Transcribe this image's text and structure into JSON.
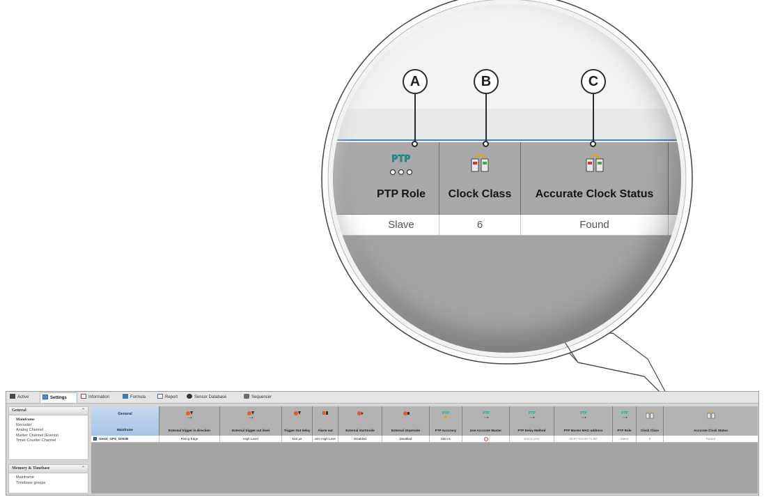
{
  "callouts": [
    "A",
    "B",
    "C"
  ],
  "zoom": {
    "columns": [
      {
        "title": "PTP Role",
        "value": "Slave",
        "icon": "ptp-icon"
      },
      {
        "title": "Clock Class",
        "value": "6",
        "icon": "clock-modules-icon"
      },
      {
        "title": "Accurate Clock Status",
        "value": "Found",
        "icon": "clock-modules-icon"
      }
    ]
  },
  "tabs": [
    {
      "label": "Active",
      "icon": "grid-icon",
      "active": false
    },
    {
      "label": "Settings",
      "icon": "settings-icon",
      "active": true
    },
    {
      "label": "Information",
      "icon": "info-icon",
      "active": false
    },
    {
      "label": "Formula",
      "icon": "formula-icon",
      "active": false
    },
    {
      "label": "Report",
      "icon": "report-icon",
      "active": false
    },
    {
      "label": "Sensor Database",
      "icon": "add-circle-icon",
      "active": false
    },
    {
      "label": "Sequencer",
      "icon": "sequencer-icon",
      "active": false
    }
  ],
  "sidebar": {
    "panels": [
      {
        "title": "General",
        "items": [
          {
            "label": "Mainframe",
            "bold": true
          },
          {
            "label": "Recorder",
            "bold": false
          },
          {
            "label": "Analog Channel",
            "bold": false
          },
          {
            "label": "Marker Channel (Events)",
            "bold": false
          },
          {
            "label": "Timer-Counter Channel",
            "bold": false
          }
        ]
      },
      {
        "title": "Memory & Timebase",
        "items": [
          {
            "label": "Mainframe",
            "bold": false
          },
          {
            "label": "Timebase groups",
            "bold": false
          }
        ]
      }
    ]
  },
  "table": {
    "group_header": "General",
    "columns": [
      {
        "label": "Mainframe",
        "icon": ""
      },
      {
        "label": "External trigger in direction",
        "icon": "trigger-icon"
      },
      {
        "label": "External trigger out level",
        "icon": "trigger-icon"
      },
      {
        "label": "Trigger Out delay",
        "icon": "trigger-icon"
      },
      {
        "label": "Alarm out",
        "icon": "alarm-icon"
      },
      {
        "label": "External startmode",
        "icon": "start-icon"
      },
      {
        "label": "External stopmode",
        "icon": "stop-icon"
      },
      {
        "label": "PTP Accuracy",
        "icon": "ptp-icon"
      },
      {
        "label": "Use Accurate Master",
        "icon": "ptp-icon"
      },
      {
        "label": "PTP Delay Method",
        "icon": "ptp-icon"
      },
      {
        "label": "PTP Master MAC-address",
        "icon": "ptp-icon"
      },
      {
        "label": "PTP Role",
        "icon": "ptp-icon"
      },
      {
        "label": "Clock Class",
        "icon": "clock-modules-icon"
      },
      {
        "label": "Accurate Clock Status",
        "icon": "clock-modules-icon"
      }
    ],
    "rows": [
      [
        "Gen3i_GPS_G002B",
        "Rising Edge",
        "High Level",
        "516 µs",
        "arm High Leve",
        "Disabled",
        "Disabled",
        "150 ns",
        "",
        "End to end",
        "20-E7-C0-00-71-3D",
        "Slave",
        "6",
        "Found"
      ]
    ]
  },
  "colors": {
    "accent": "#3c6fa8",
    "header_gray": "#b2b2b2",
    "error": "#e0442a",
    "ptp": "#1aa3a3"
  }
}
